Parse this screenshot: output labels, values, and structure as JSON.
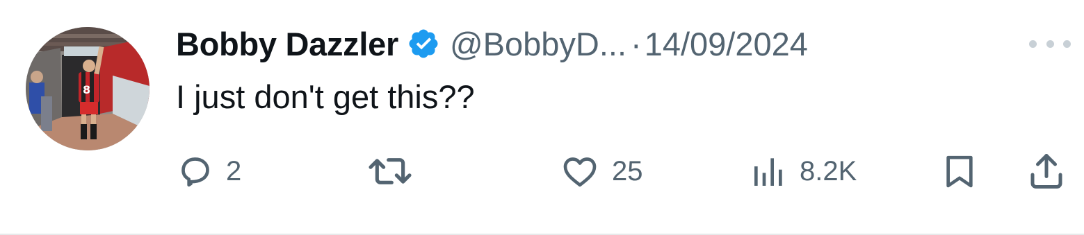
{
  "tweet": {
    "author": {
      "name": "Bobby Dazzler",
      "verified": true,
      "handle": "@BobbyD...",
      "avatar_icon": "avatar-photo-footballer"
    },
    "separator": "·",
    "date": "14/09/2024",
    "text": "I just don't get this??",
    "actions": {
      "replies": {
        "icon": "reply-icon",
        "count": "2"
      },
      "reposts": {
        "icon": "repost-icon",
        "count": ""
      },
      "likes": {
        "icon": "heart-icon",
        "count": "25"
      },
      "views": {
        "icon": "views-icon",
        "count": "8.2K"
      },
      "bookmark": {
        "icon": "bookmark-icon"
      },
      "share": {
        "icon": "share-icon"
      }
    },
    "colors": {
      "text_primary": "#0f1419",
      "text_secondary": "#536471",
      "verified_blue": "#1d9bf0",
      "background": "#ffffff"
    }
  }
}
